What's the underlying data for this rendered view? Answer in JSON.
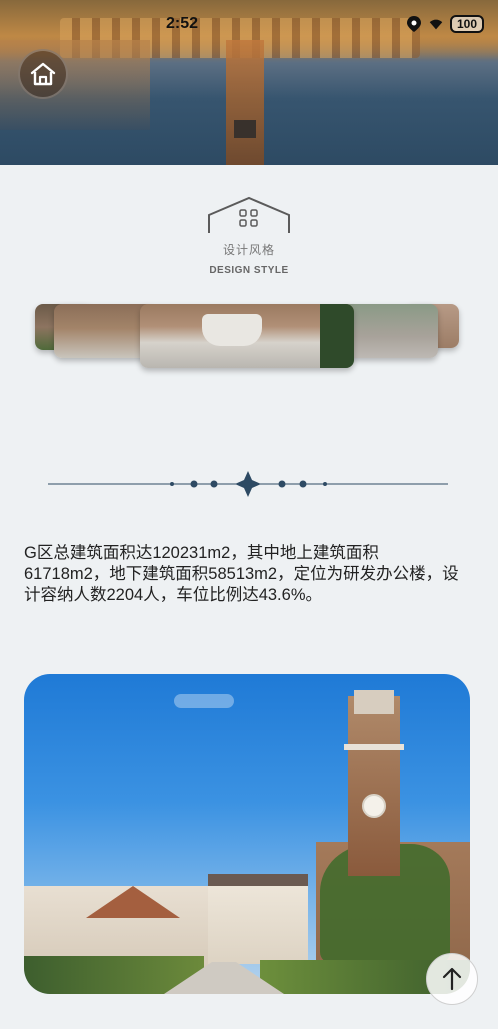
{
  "statusbar": {
    "time": "2:52",
    "battery": "100"
  },
  "hero": {
    "home_icon": "home-icon"
  },
  "section": {
    "title": "设计风格",
    "subtitle": "DESIGN STYLE"
  },
  "content": {
    "description": "G区总建筑面积达120231m2，其中地上建筑面积61718m2，地下建筑面积58513m2，定位为研发办公楼，设计容纳人数2204人，车位比例达43.6%。"
  },
  "colors": {
    "accent": "#2d4a63",
    "background": "#eef1f3"
  },
  "scroll_top_icon": "arrow-up-icon"
}
